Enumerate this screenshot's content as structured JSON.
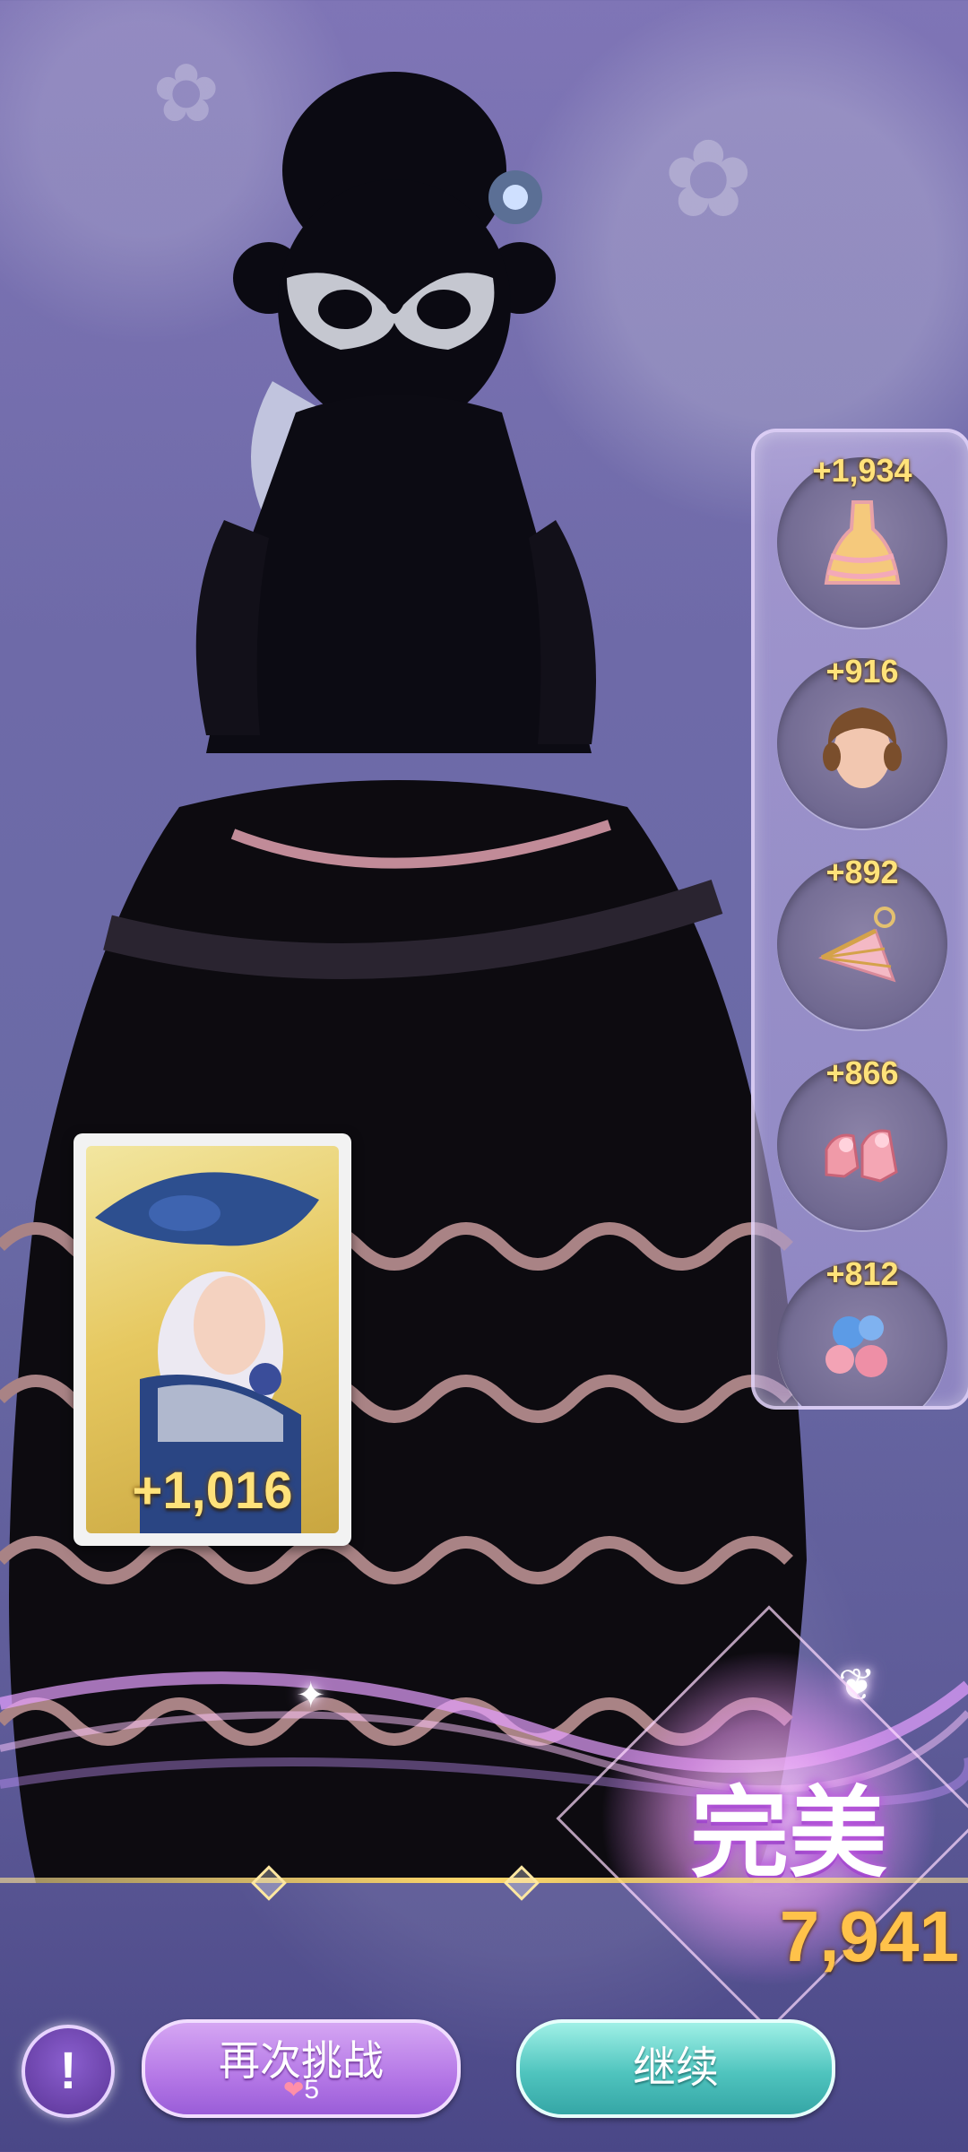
{
  "rewards": [
    {
      "score": "+1,934",
      "icon": "dress-icon"
    },
    {
      "score": "+916",
      "icon": "hair-icon"
    },
    {
      "score": "+892",
      "icon": "fan-icon"
    },
    {
      "score": "+866",
      "icon": "shoes-icon"
    },
    {
      "score": "+812",
      "icon": "roses-icon"
    }
  ],
  "card": {
    "score": "+1,016"
  },
  "result": {
    "rating": "完美",
    "total_score": "7,941"
  },
  "buttons": {
    "hint_icon": "!",
    "retry_label": "再次挑战",
    "retry_cost": "5",
    "continue_label": "继续"
  },
  "colors": {
    "accent_gold": "#ffc24a",
    "retry_purple": "#b477e6",
    "continue_teal": "#4fc4be"
  }
}
